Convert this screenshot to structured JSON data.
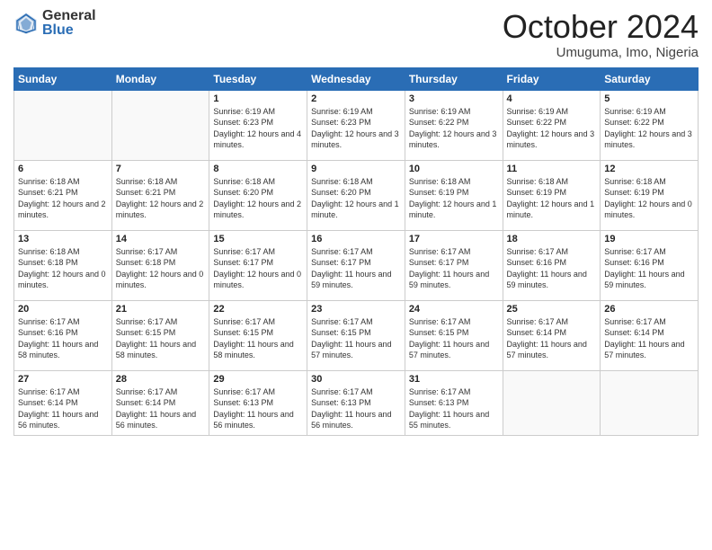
{
  "logo": {
    "general": "General",
    "blue": "Blue"
  },
  "header": {
    "month": "October 2024",
    "location": "Umuguma, Imo, Nigeria"
  },
  "weekdays": [
    "Sunday",
    "Monday",
    "Tuesday",
    "Wednesday",
    "Thursday",
    "Friday",
    "Saturday"
  ],
  "weeks": [
    [
      {
        "day": "",
        "sunrise": "",
        "sunset": "",
        "daylight": ""
      },
      {
        "day": "",
        "sunrise": "",
        "sunset": "",
        "daylight": ""
      },
      {
        "day": "1",
        "sunrise": "Sunrise: 6:19 AM",
        "sunset": "Sunset: 6:23 PM",
        "daylight": "Daylight: 12 hours and 4 minutes."
      },
      {
        "day": "2",
        "sunrise": "Sunrise: 6:19 AM",
        "sunset": "Sunset: 6:23 PM",
        "daylight": "Daylight: 12 hours and 3 minutes."
      },
      {
        "day": "3",
        "sunrise": "Sunrise: 6:19 AM",
        "sunset": "Sunset: 6:22 PM",
        "daylight": "Daylight: 12 hours and 3 minutes."
      },
      {
        "day": "4",
        "sunrise": "Sunrise: 6:19 AM",
        "sunset": "Sunset: 6:22 PM",
        "daylight": "Daylight: 12 hours and 3 minutes."
      },
      {
        "day": "5",
        "sunrise": "Sunrise: 6:19 AM",
        "sunset": "Sunset: 6:22 PM",
        "daylight": "Daylight: 12 hours and 3 minutes."
      }
    ],
    [
      {
        "day": "6",
        "sunrise": "Sunrise: 6:18 AM",
        "sunset": "Sunset: 6:21 PM",
        "daylight": "Daylight: 12 hours and 2 minutes."
      },
      {
        "day": "7",
        "sunrise": "Sunrise: 6:18 AM",
        "sunset": "Sunset: 6:21 PM",
        "daylight": "Daylight: 12 hours and 2 minutes."
      },
      {
        "day": "8",
        "sunrise": "Sunrise: 6:18 AM",
        "sunset": "Sunset: 6:20 PM",
        "daylight": "Daylight: 12 hours and 2 minutes."
      },
      {
        "day": "9",
        "sunrise": "Sunrise: 6:18 AM",
        "sunset": "Sunset: 6:20 PM",
        "daylight": "Daylight: 12 hours and 1 minute."
      },
      {
        "day": "10",
        "sunrise": "Sunrise: 6:18 AM",
        "sunset": "Sunset: 6:19 PM",
        "daylight": "Daylight: 12 hours and 1 minute."
      },
      {
        "day": "11",
        "sunrise": "Sunrise: 6:18 AM",
        "sunset": "Sunset: 6:19 PM",
        "daylight": "Daylight: 12 hours and 1 minute."
      },
      {
        "day": "12",
        "sunrise": "Sunrise: 6:18 AM",
        "sunset": "Sunset: 6:19 PM",
        "daylight": "Daylight: 12 hours and 0 minutes."
      }
    ],
    [
      {
        "day": "13",
        "sunrise": "Sunrise: 6:18 AM",
        "sunset": "Sunset: 6:18 PM",
        "daylight": "Daylight: 12 hours and 0 minutes."
      },
      {
        "day": "14",
        "sunrise": "Sunrise: 6:17 AM",
        "sunset": "Sunset: 6:18 PM",
        "daylight": "Daylight: 12 hours and 0 minutes."
      },
      {
        "day": "15",
        "sunrise": "Sunrise: 6:17 AM",
        "sunset": "Sunset: 6:17 PM",
        "daylight": "Daylight: 12 hours and 0 minutes."
      },
      {
        "day": "16",
        "sunrise": "Sunrise: 6:17 AM",
        "sunset": "Sunset: 6:17 PM",
        "daylight": "Daylight: 11 hours and 59 minutes."
      },
      {
        "day": "17",
        "sunrise": "Sunrise: 6:17 AM",
        "sunset": "Sunset: 6:17 PM",
        "daylight": "Daylight: 11 hours and 59 minutes."
      },
      {
        "day": "18",
        "sunrise": "Sunrise: 6:17 AM",
        "sunset": "Sunset: 6:16 PM",
        "daylight": "Daylight: 11 hours and 59 minutes."
      },
      {
        "day": "19",
        "sunrise": "Sunrise: 6:17 AM",
        "sunset": "Sunset: 6:16 PM",
        "daylight": "Daylight: 11 hours and 59 minutes."
      }
    ],
    [
      {
        "day": "20",
        "sunrise": "Sunrise: 6:17 AM",
        "sunset": "Sunset: 6:16 PM",
        "daylight": "Daylight: 11 hours and 58 minutes."
      },
      {
        "day": "21",
        "sunrise": "Sunrise: 6:17 AM",
        "sunset": "Sunset: 6:15 PM",
        "daylight": "Daylight: 11 hours and 58 minutes."
      },
      {
        "day": "22",
        "sunrise": "Sunrise: 6:17 AM",
        "sunset": "Sunset: 6:15 PM",
        "daylight": "Daylight: 11 hours and 58 minutes."
      },
      {
        "day": "23",
        "sunrise": "Sunrise: 6:17 AM",
        "sunset": "Sunset: 6:15 PM",
        "daylight": "Daylight: 11 hours and 57 minutes."
      },
      {
        "day": "24",
        "sunrise": "Sunrise: 6:17 AM",
        "sunset": "Sunset: 6:15 PM",
        "daylight": "Daylight: 11 hours and 57 minutes."
      },
      {
        "day": "25",
        "sunrise": "Sunrise: 6:17 AM",
        "sunset": "Sunset: 6:14 PM",
        "daylight": "Daylight: 11 hours and 57 minutes."
      },
      {
        "day": "26",
        "sunrise": "Sunrise: 6:17 AM",
        "sunset": "Sunset: 6:14 PM",
        "daylight": "Daylight: 11 hours and 57 minutes."
      }
    ],
    [
      {
        "day": "27",
        "sunrise": "Sunrise: 6:17 AM",
        "sunset": "Sunset: 6:14 PM",
        "daylight": "Daylight: 11 hours and 56 minutes."
      },
      {
        "day": "28",
        "sunrise": "Sunrise: 6:17 AM",
        "sunset": "Sunset: 6:14 PM",
        "daylight": "Daylight: 11 hours and 56 minutes."
      },
      {
        "day": "29",
        "sunrise": "Sunrise: 6:17 AM",
        "sunset": "Sunset: 6:13 PM",
        "daylight": "Daylight: 11 hours and 56 minutes."
      },
      {
        "day": "30",
        "sunrise": "Sunrise: 6:17 AM",
        "sunset": "Sunset: 6:13 PM",
        "daylight": "Daylight: 11 hours and 56 minutes."
      },
      {
        "day": "31",
        "sunrise": "Sunrise: 6:17 AM",
        "sunset": "Sunset: 6:13 PM",
        "daylight": "Daylight: 11 hours and 55 minutes."
      },
      {
        "day": "",
        "sunrise": "",
        "sunset": "",
        "daylight": ""
      },
      {
        "day": "",
        "sunrise": "",
        "sunset": "",
        "daylight": ""
      }
    ]
  ]
}
